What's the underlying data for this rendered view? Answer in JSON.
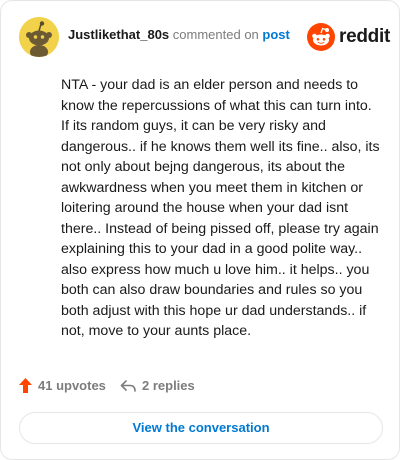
{
  "comment": {
    "username": "Justlikethat_80s",
    "action_text": "commented on",
    "post_link": "post",
    "body": "NTA - your dad is an elder person and needs to know the repercussions of what this can turn into. If its random guys, it can be very risky and dangerous.. if he knows them well its fine.. also, its not only about bejng dangerous, its about the awkwardness when you meet them in kitchen or loitering around the house when your dad isnt there.. Instead of being pissed off, please try again explaining this to your dad in a good polite way.. also express how much u love him.. it helps.. you both can also draw boundaries and rules so you both adjust with this hope ur dad understands.. if not, move to your aunts place."
  },
  "brand": {
    "name": "reddit",
    "logo_color": "#ff4500"
  },
  "actions": {
    "upvotes_label": "41 upvotes",
    "replies_label": "2 replies",
    "upvote_color": "#ff4500"
  },
  "cta": {
    "view_conversation": "View the conversation"
  },
  "icons": {
    "avatar": "snoo-avatar",
    "logo": "reddit-logo-icon",
    "upvote": "upvote-arrow-icon",
    "reply": "reply-arrow-icon"
  },
  "colors": {
    "link": "#0079d3",
    "muted": "#7c7c7c",
    "avatar_bg": "#f2d24a"
  }
}
